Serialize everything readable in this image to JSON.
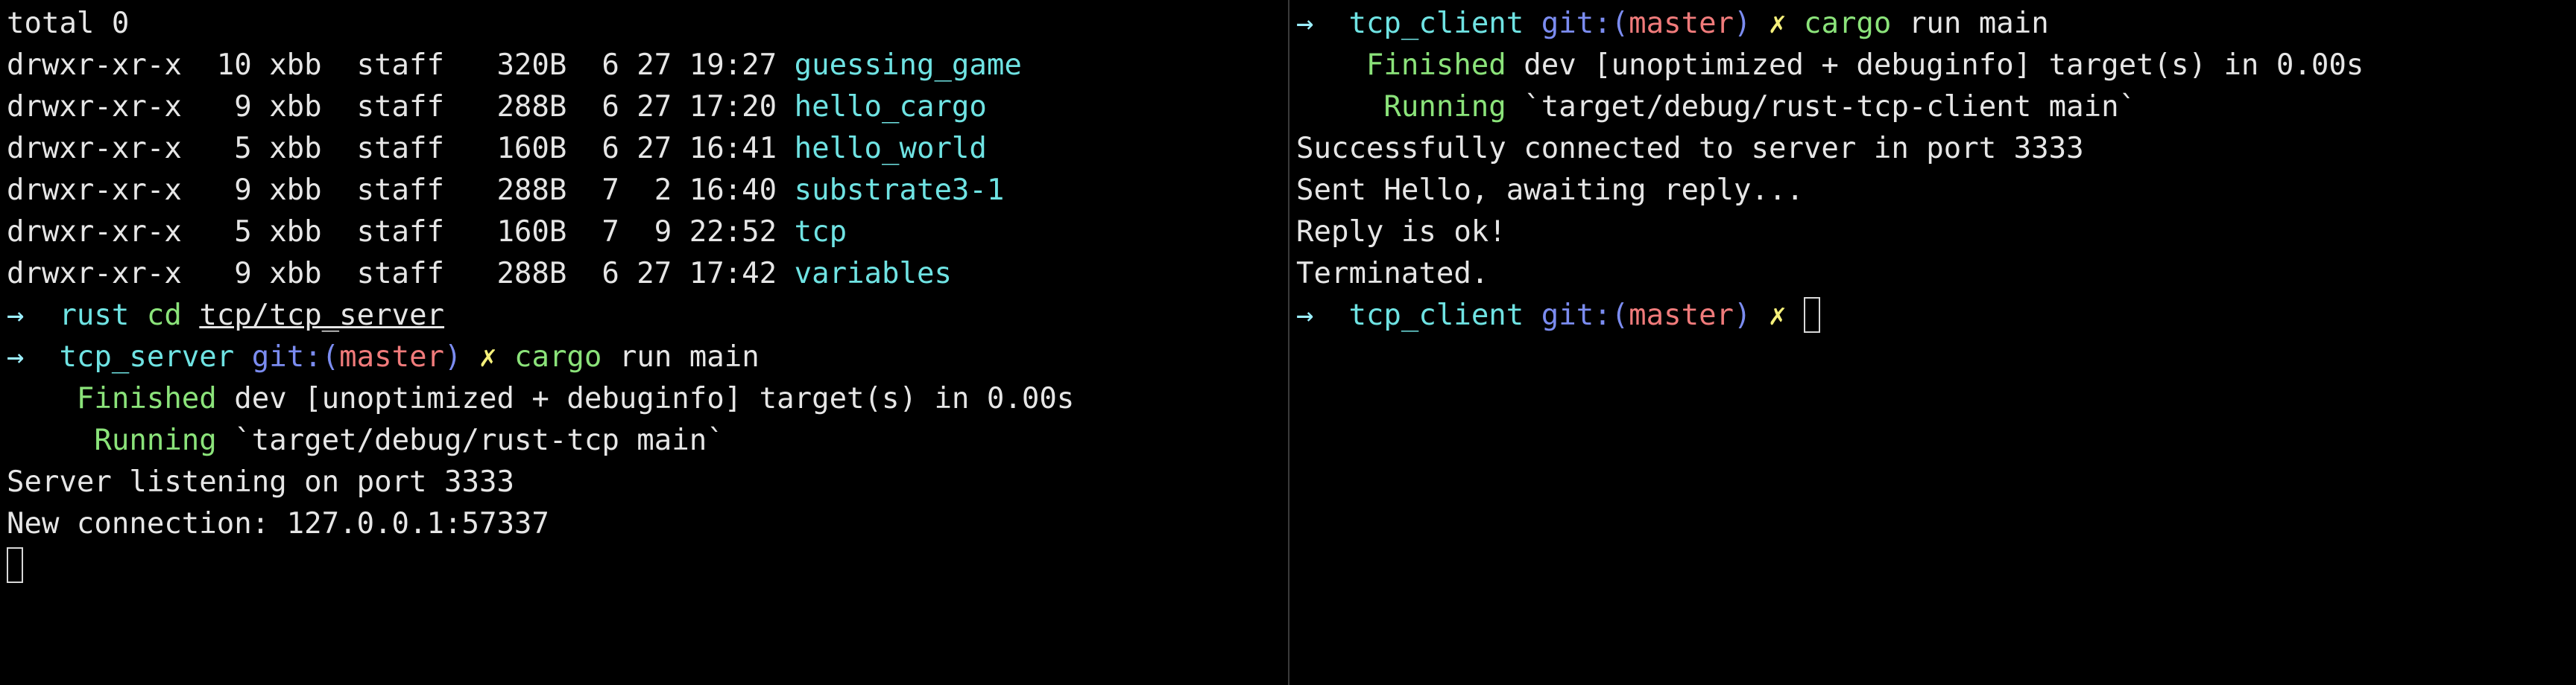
{
  "colors": {
    "text": "#e6e6e6",
    "directory": "#6fe3e3",
    "prompt_dir": "#6fe3e3",
    "arrow": "#9cf0ff",
    "git_label": "#7b8cf0",
    "branch": "#f07b7b",
    "dirty_mark": "#f5f07a",
    "command": "#8be37a",
    "status_green": "#8be37a"
  },
  "icons": {
    "prompt_arrow": "arrow-right-icon",
    "dirty": "x-mark-icon",
    "cursor": "block-cursor-icon"
  },
  "left_pane": {
    "total_line": "total 0",
    "listing": [
      {
        "perms": "drwxr-xr-x",
        "links": "10",
        "owner": "xbb",
        "group": "staff",
        "size": "320B",
        "month": "6",
        "day": "27",
        "time": "19:27",
        "name": "guessing_game"
      },
      {
        "perms": "drwxr-xr-x",
        "links": "9",
        "owner": "xbb",
        "group": "staff",
        "size": "288B",
        "month": "6",
        "day": "27",
        "time": "17:20",
        "name": "hello_cargo"
      },
      {
        "perms": "drwxr-xr-x",
        "links": "5",
        "owner": "xbb",
        "group": "staff",
        "size": "160B",
        "month": "6",
        "day": "27",
        "time": "16:41",
        "name": "hello_world"
      },
      {
        "perms": "drwxr-xr-x",
        "links": "9",
        "owner": "xbb",
        "group": "staff",
        "size": "288B",
        "month": "7",
        "day": "2",
        "time": "16:40",
        "name": "substrate3-1"
      },
      {
        "perms": "drwxr-xr-x",
        "links": "5",
        "owner": "xbb",
        "group": "staff",
        "size": "160B",
        "month": "7",
        "day": "9",
        "time": "22:52",
        "name": "tcp"
      },
      {
        "perms": "drwxr-xr-x",
        "links": "9",
        "owner": "xbb",
        "group": "staff",
        "size": "288B",
        "month": "6",
        "day": "27",
        "time": "17:42",
        "name": "variables"
      }
    ],
    "prompt1": {
      "arrow": "→",
      "dir": "rust",
      "command": "cd",
      "arg": "tcp/tcp_server"
    },
    "prompt2": {
      "arrow": "→",
      "dir": "tcp_server",
      "git_label": "git:(",
      "branch": "master",
      "git_close": ")",
      "dirty": "✗",
      "command": "cargo",
      "args": "run main"
    },
    "finished_label": "Finished",
    "finished_text": "dev [unoptimized + debuginfo] target(s) in 0.00s",
    "running_label": "Running",
    "running_text": "`target/debug/rust-tcp main`",
    "output": [
      "Server listening on port 3333",
      "New connection: 127.0.0.1:57337"
    ]
  },
  "right_pane": {
    "prompt1": {
      "arrow": "→",
      "dir": "tcp_client",
      "git_label": "git:(",
      "branch": "master",
      "git_close": ")",
      "dirty": "✗",
      "command": "cargo",
      "args": "run main"
    },
    "finished_label": "Finished",
    "finished_text": "dev [unoptimized + debuginfo] target(s) in 0.00s",
    "running_label": "Running",
    "running_text": "`target/debug/rust-tcp-client main`",
    "output": [
      "Successfully connected to server in port 3333",
      "Sent Hello, awaiting reply...",
      "Reply is ok!",
      "Terminated."
    ],
    "prompt2": {
      "arrow": "→",
      "dir": "tcp_client",
      "git_label": "git:(",
      "branch": "master",
      "git_close": ")",
      "dirty": "✗"
    }
  }
}
